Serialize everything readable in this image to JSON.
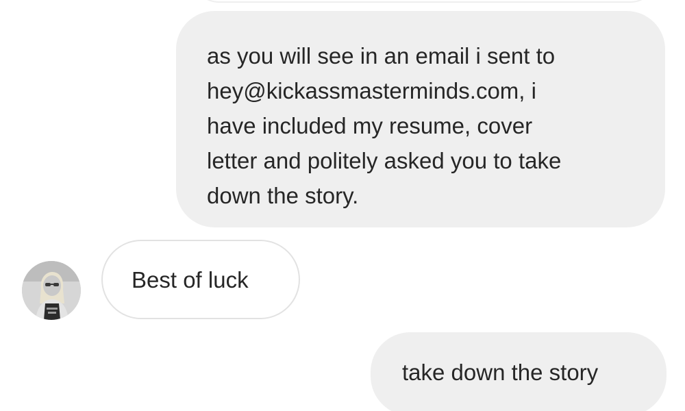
{
  "messages": [
    {
      "direction": "outgoing",
      "lines": [
        "as you will see in an email i sent to",
        "hey@kickassmasterminds.com, i",
        "have included my resume, cover",
        "letter and politely asked you to take",
        "down the story."
      ]
    },
    {
      "direction": "incoming",
      "text": "Best of luck"
    },
    {
      "direction": "outgoing",
      "text": "take down the story"
    }
  ],
  "colors": {
    "outgoing_bubble": "#efefef",
    "incoming_border": "#e2e2e2",
    "text": "#262626"
  }
}
